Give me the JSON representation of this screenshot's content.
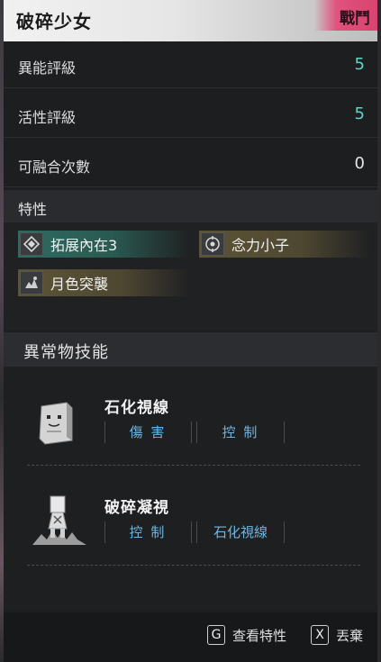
{
  "header": {
    "title": "破碎少女",
    "category_tag": "戰鬥"
  },
  "stats": [
    {
      "label": "異能評級",
      "value": "5",
      "highlight": true
    },
    {
      "label": "活性評級",
      "value": "5",
      "highlight": true
    },
    {
      "label": "可融合次數",
      "value": "0",
      "highlight": false
    }
  ],
  "traits": {
    "title": "特性",
    "items": [
      {
        "label": "拓展內在3",
        "icon": "diamond-icon",
        "color": "#2f6a60"
      },
      {
        "label": "念力小子",
        "icon": "target-icon",
        "color": "#5d5437"
      },
      {
        "label": "月色突襲",
        "icon": "moon-attack-icon",
        "color": "#5d5437"
      }
    ]
  },
  "skills": {
    "title": "異常物技能",
    "items": [
      {
        "name": "石化視線",
        "icon": "stone-block-icon",
        "tags": [
          "傷 害",
          "控 制"
        ]
      },
      {
        "name": "破碎凝視",
        "icon": "broken-girl-icon",
        "tags": [
          "控 制",
          "石化視線"
        ]
      }
    ]
  },
  "footer": {
    "view_key": "G",
    "view_label": "查看特性",
    "discard_key": "X",
    "discard_label": "丟棄"
  },
  "colors": {
    "accent_teal": "#5fd6c4",
    "tag_blue": "#6fb6e0",
    "category_pink": "#e0527e"
  }
}
